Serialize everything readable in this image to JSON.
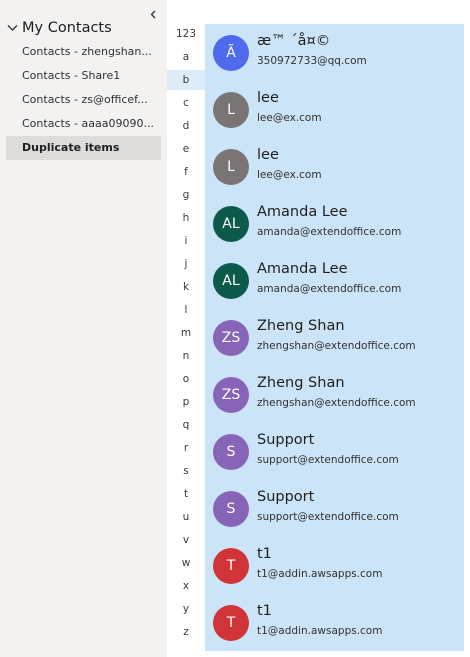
{
  "nav": {
    "group_title": "My Contacts",
    "folders": [
      {
        "label": "Contacts - zhengshan..."
      },
      {
        "label": "Contacts - Share1"
      },
      {
        "label": "Contacts - zs@officef..."
      },
      {
        "label": "Contacts - aaaa09090..."
      },
      {
        "label": "Duplicate items",
        "selected": true
      }
    ]
  },
  "alphabet": {
    "letters": [
      "123",
      "a",
      "b",
      "c",
      "d",
      "e",
      "f",
      "g",
      "h",
      "i",
      "j",
      "k",
      "l",
      "m",
      "n",
      "o",
      "p",
      "q",
      "r",
      "s",
      "t",
      "u",
      "v",
      "w",
      "x",
      "y",
      "z"
    ],
    "active": "b"
  },
  "contacts": [
    {
      "initials": "Ã",
      "name": "æ™ ´å¤©",
      "email": "350972733@qq.com",
      "color": "#4f6bed"
    },
    {
      "initials": "L",
      "name": "lee",
      "email": "lee@ex.com",
      "color": "#7a7574"
    },
    {
      "initials": "L",
      "name": "lee",
      "email": "lee@ex.com",
      "color": "#7a7574"
    },
    {
      "initials": "AL",
      "name": "Amanda Lee",
      "email": "amanda@extendoffice.com",
      "color": "#0b5a4b"
    },
    {
      "initials": "AL",
      "name": "Amanda Lee",
      "email": "amanda@extendoffice.com",
      "color": "#0b5a4b"
    },
    {
      "initials": "ZS",
      "name": "Zheng Shan",
      "email": "zhengshan@extendoffice.com",
      "color": "#8764b8"
    },
    {
      "initials": "ZS",
      "name": "Zheng Shan",
      "email": "zhengshan@extendoffice.com",
      "color": "#8764b8"
    },
    {
      "initials": "S",
      "name": "Support",
      "email": "support@extendoffice.com",
      "color": "#8764b8"
    },
    {
      "initials": "S",
      "name": "Support",
      "email": "support@extendoffice.com",
      "color": "#8764b8"
    },
    {
      "initials": "T",
      "name": "t1",
      "email": "t1@addin.awsapps.com",
      "color": "#d13438"
    },
    {
      "initials": "T",
      "name": "t1",
      "email": "t1@addin.awsapps.com",
      "color": "#d13438"
    }
  ],
  "icons": {
    "collapse": "chevron-left-icon",
    "group_toggle": "chevron-down-icon"
  },
  "colors": {
    "nav_bg": "#f3f2f1",
    "list_bg": "#cce4f7",
    "selected_folder": "#dddcda",
    "active_letter": "#deecf9"
  }
}
